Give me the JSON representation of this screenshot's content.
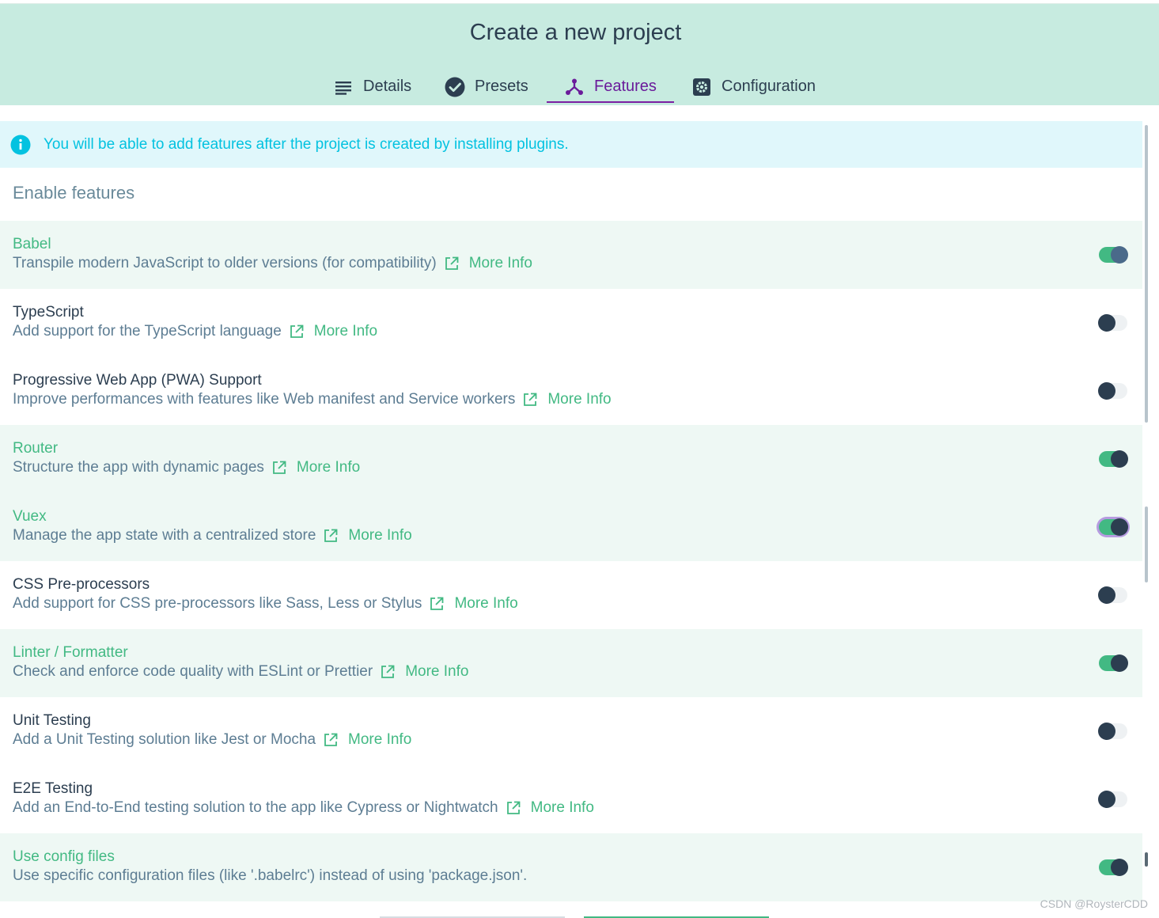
{
  "header": {
    "title": "Create a new project",
    "tabs": [
      {
        "label": "Details",
        "icon": "list-icon"
      },
      {
        "label": "Presets",
        "icon": "check-circle-icon"
      },
      {
        "label": "Features",
        "icon": "fork-icon"
      },
      {
        "label": "Configuration",
        "icon": "gear-icon"
      }
    ],
    "active_tab": "Features"
  },
  "info": {
    "text": "You will be able to add features after the project is created by installing plugins.",
    "icon": "info-icon"
  },
  "section_title": "Enable features",
  "more_info_label": "More Info",
  "features": [
    {
      "name": "Babel",
      "description": "Transpile modern JavaScript to older versions (for compatibility)",
      "more_info": "More Info",
      "enabled": true
    },
    {
      "name": "TypeScript",
      "description": "Add support for the TypeScript language",
      "more_info": "More Info",
      "enabled": false
    },
    {
      "name": "Progressive Web App (PWA) Support",
      "description": "Improve performances with features like Web manifest and Service workers",
      "more_info": "More Info",
      "enabled": false
    },
    {
      "name": "Router",
      "description": "Structure the app with dynamic pages",
      "more_info": "More Info",
      "enabled": true
    },
    {
      "name": "Vuex",
      "description": "Manage the app state with a centralized store",
      "more_info": "More Info",
      "enabled": true
    },
    {
      "name": "CSS Pre-processors",
      "description": "Add support for CSS pre-processors like Sass, Less or Stylus",
      "more_info": "More Info",
      "enabled": false
    },
    {
      "name": "Linter / Formatter",
      "description": "Check and enforce code quality with ESLint or Prettier",
      "more_info": "More Info",
      "enabled": true
    },
    {
      "name": "Unit Testing",
      "description": "Add a Unit Testing solution like Jest or Mocha",
      "more_info": "More Info",
      "enabled": false
    },
    {
      "name": "E2E Testing",
      "description": "Add an End-to-End testing solution to the app like Cypress or Nightwatch",
      "more_info": "More Info",
      "enabled": false
    },
    {
      "name": "Use config files",
      "description": "Use specific configuration files (like '.babelrc') instead of using 'package.json'.",
      "more_info": "",
      "enabled": true
    }
  ],
  "colors": {
    "accent": "#42b983",
    "header_bg": "#c7ebe0",
    "active_tab": "#6a1b9a",
    "info": "#03c2e0",
    "dark": "#2c3e50"
  },
  "watermark": "CSDN @RoysterCDD"
}
